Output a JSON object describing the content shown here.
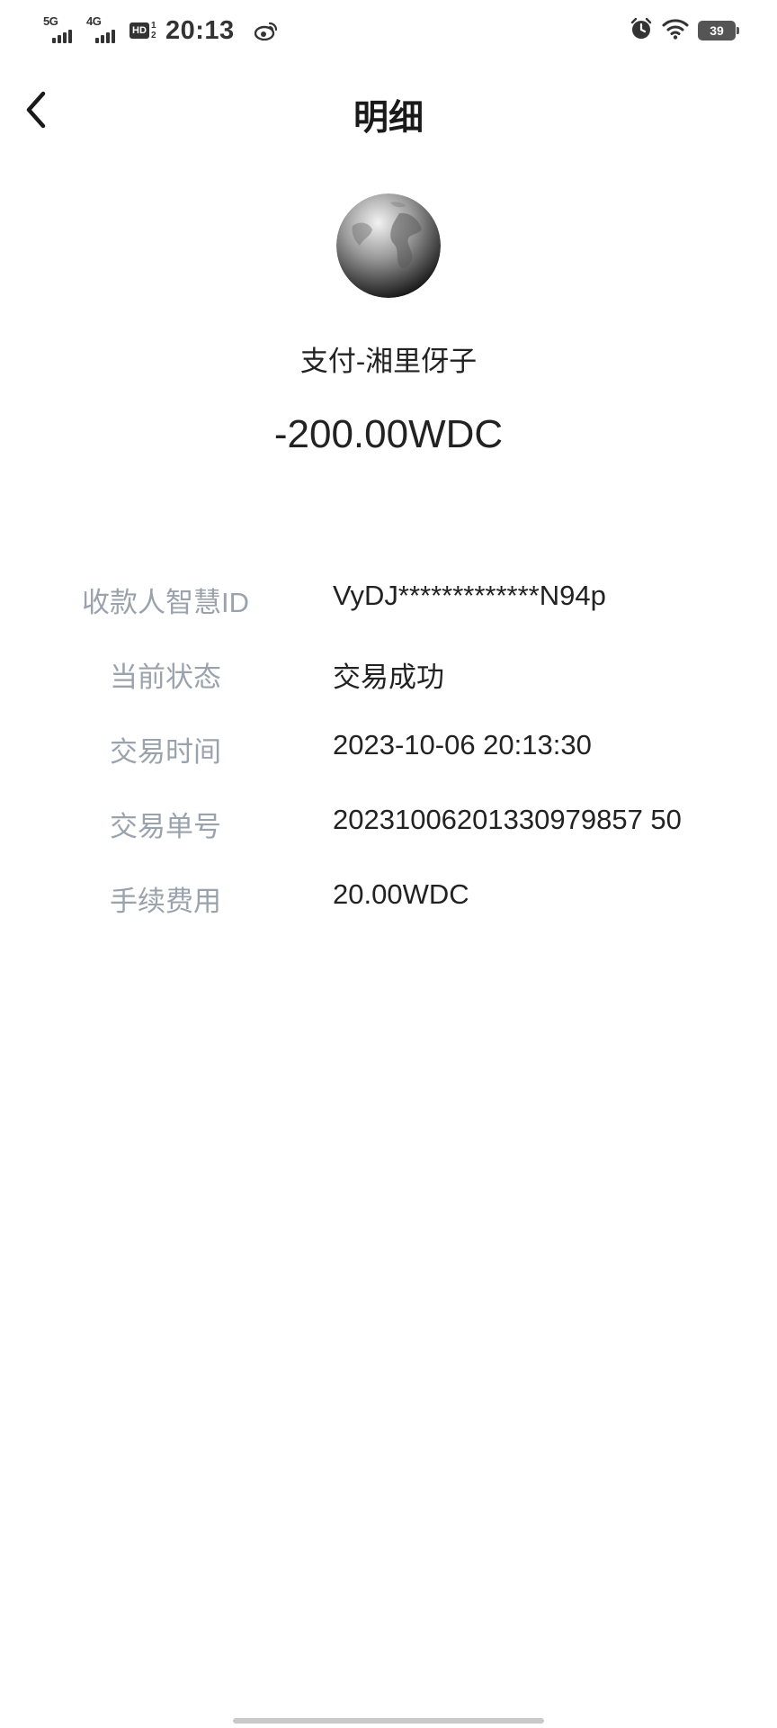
{
  "status_bar": {
    "network1_label": "5G",
    "network2_label": "4G",
    "hd_label": "HD",
    "hd_sub": "1",
    "hd_sub2": "2",
    "time": "20:13",
    "battery_level": "39",
    "icons": [
      "weibo-icon",
      "alarm-icon",
      "wifi-icon",
      "battery-icon"
    ]
  },
  "nav": {
    "title": "明细",
    "back_icon": "chevron-left-icon"
  },
  "transaction": {
    "avatar_icon": "globe-icon",
    "payee": "支付-湘里伢子",
    "amount": "-200.00WDC"
  },
  "details": [
    {
      "label": "收款人智慧ID",
      "value": "VyDJ*************N94p"
    },
    {
      "label": "当前状态",
      "value": "交易成功"
    },
    {
      "label": "交易时间",
      "value": "2023-10-06 20:13:30"
    },
    {
      "label": "交易单号",
      "value": "20231006201330979857 50"
    },
    {
      "label": "手续费用",
      "value": "20.00WDC"
    }
  ],
  "colors": {
    "label_gray": "#9aa3ad",
    "text_dark": "#222222",
    "background": "#ffffff"
  }
}
